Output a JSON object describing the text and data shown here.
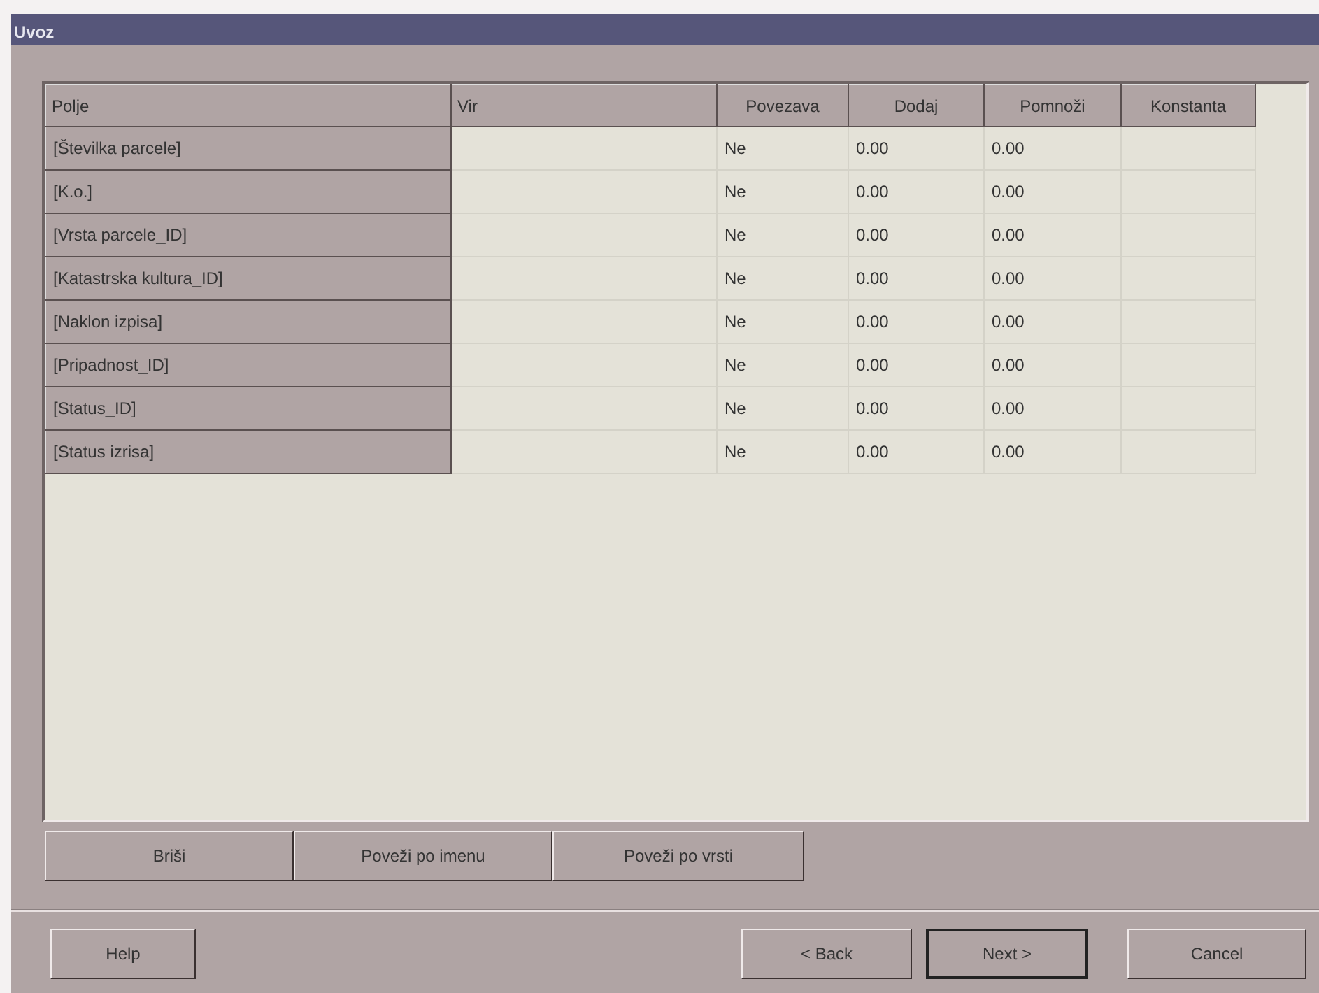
{
  "window": {
    "title": "Uvoz"
  },
  "table": {
    "columns": [
      "Polje",
      "Vir",
      "Povezava",
      "Dodaj",
      "Pomnoži",
      "Konstanta"
    ],
    "rows": [
      {
        "polje": "[Številka parcele]",
        "povezava": "Ne",
        "dodaj": "0.00",
        "pomnozi": "0.00"
      },
      {
        "polje": "[K.o.]",
        "povezava": "Ne",
        "dodaj": "0.00",
        "pomnozi": "0.00"
      },
      {
        "polje": "[Vrsta parcele_ID]",
        "povezava": "Ne",
        "dodaj": "0.00",
        "pomnozi": "0.00"
      },
      {
        "polje": "[Katastrska kultura_ID]",
        "povezava": "Ne",
        "dodaj": "0.00",
        "pomnozi": "0.00"
      },
      {
        "polje": "[Naklon izpisa]",
        "povezava": "Ne",
        "dodaj": "0.00",
        "pomnozi": "0.00"
      },
      {
        "polje": "[Pripadnost_ID]",
        "povezava": "Ne",
        "dodaj": "0.00",
        "pomnozi": "0.00"
      },
      {
        "polje": "[Status_ID]",
        "povezava": "Ne",
        "dodaj": "0.00",
        "pomnozi": "0.00"
      },
      {
        "polje": "[Status izrisa]",
        "povezava": "Ne",
        "dodaj": "0.00",
        "pomnozi": "0.00"
      }
    ]
  },
  "actions": [
    "Briši",
    "Poveži po imenu",
    "Poveži po vrsti"
  ],
  "footer": {
    "help": "Help",
    "back": "< Back",
    "next": "Next >",
    "cancel": "Cancel"
  }
}
